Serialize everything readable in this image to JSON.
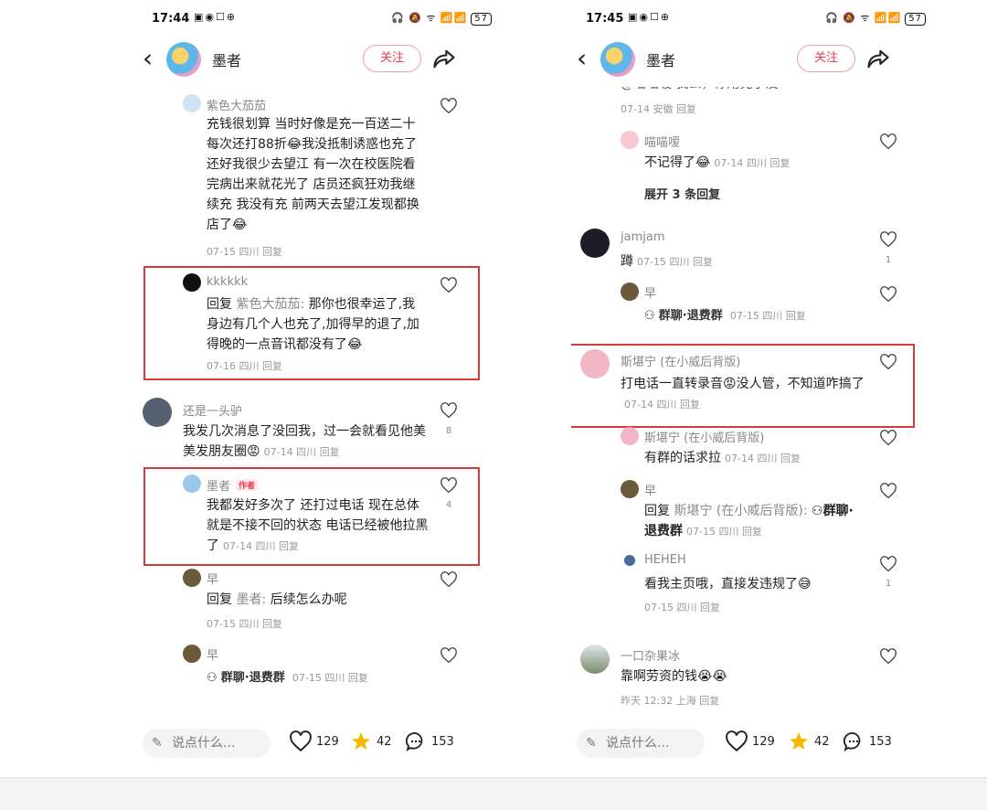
{
  "left": {
    "status": {
      "time": "17:44",
      "battery": "57"
    },
    "header": {
      "title": "墨者",
      "follow": "关注"
    },
    "comments": {
      "c1": {
        "name": "紫色大茄茄",
        "text": "充钱很划算 当时好像是充一百送二十每次还打88折😂我没抵制诱惑也充了 还好我很少去望江 有一次在校医院看完病出来就花光了 店员还疯狂劝我继续充 我没有充 前两天去望江发现都换店了😂",
        "meta": "07-15 四川 回复"
      },
      "c2": {
        "name": "kkkkkk",
        "reply_prefix": "回复",
        "reply_to": "紫色大茄茄:",
        "text": "那你也很幸运了,我身边有几个人也充了,加得早的退了,加得晚的一点音讯都没有了😂",
        "meta": "07-16 四川 回复"
      },
      "c3": {
        "name": "还是一头驴",
        "text": "我发几次消息了没回我，过一会就看见他美美发朋友圈😡",
        "meta": "07-14 四川 回复",
        "likes": "8"
      },
      "c4": {
        "name": "墨者",
        "tag": "作者",
        "text": "我都发好多次了 还打过电话  现在总体就是不接不回的状态 电话已经被他拉黑了",
        "meta": "07-14 四川 回复",
        "likes": "4"
      },
      "c5": {
        "name": "早",
        "reply_prefix": "回复",
        "reply_to": "墨者:",
        "text": "后续怎么办呢",
        "meta": "07-15 四川 回复"
      },
      "c6": {
        "name": "早",
        "group": "群聊·退费群",
        "meta": "07-15 四川 回复"
      }
    },
    "bottom": {
      "placeholder": "说点什么...",
      "likes": "129",
      "stars": "42",
      "comments": "153"
    }
  },
  "right": {
    "status": {
      "time": "17:45",
      "battery": "57"
    },
    "header": {
      "title": "墨者",
      "follow": "关注"
    },
    "comments": {
      "r0": {
        "text": "@喵喵嗳 我么，你用完了没",
        "meta": "07-14 安徽 回复"
      },
      "r1": {
        "name": "喵喵嗳",
        "text": "不记得了😂",
        "meta": "07-14 四川 回复"
      },
      "expand": "展开 3 条回复",
      "r2": {
        "name": "jamjam",
        "text": "蹲",
        "meta": "07-15 四川 回复",
        "likes": "1"
      },
      "r3": {
        "name": "早",
        "group": "群聊·退费群",
        "meta": "07-15 四川 回复"
      },
      "r4": {
        "name": "斯堪宁 (在小威后背版)",
        "text": "打电话一直转录音😡没人管，不知道咋搞了",
        "meta": "07-14 四川 回复"
      },
      "r5": {
        "name": "斯堪宁 (在小威后背版)",
        "text": "有群的话求拉",
        "meta": "07-14 四川 回复"
      },
      "r6": {
        "name": "早",
        "reply_prefix": "回复",
        "reply_to": "斯堪宁 (在小威后背版):",
        "group": "群聊·退费群",
        "meta": "07-15 四川 回复"
      },
      "r7": {
        "name": "HEHEH",
        "text": "看我主页哦，直接发违规了😅",
        "meta": "07-15 四川 回复",
        "likes": "1"
      },
      "r8": {
        "name": "一口杂果冰",
        "text": "靠啊劳资的钱😭😭",
        "meta": "昨天 12:32 上海 回复"
      }
    },
    "bottom": {
      "placeholder": "说点什么...",
      "likes": "129",
      "stars": "42",
      "comments": "153"
    }
  },
  "colors": {
    "accent": "#ee3a4e",
    "highlight_box": "#d83a3a",
    "star": "#f5b800"
  },
  "icons": [
    "back-icon",
    "share-icon",
    "heart-icon",
    "star-icon",
    "comment-icon",
    "pencil-icon",
    "group-icon"
  ]
}
